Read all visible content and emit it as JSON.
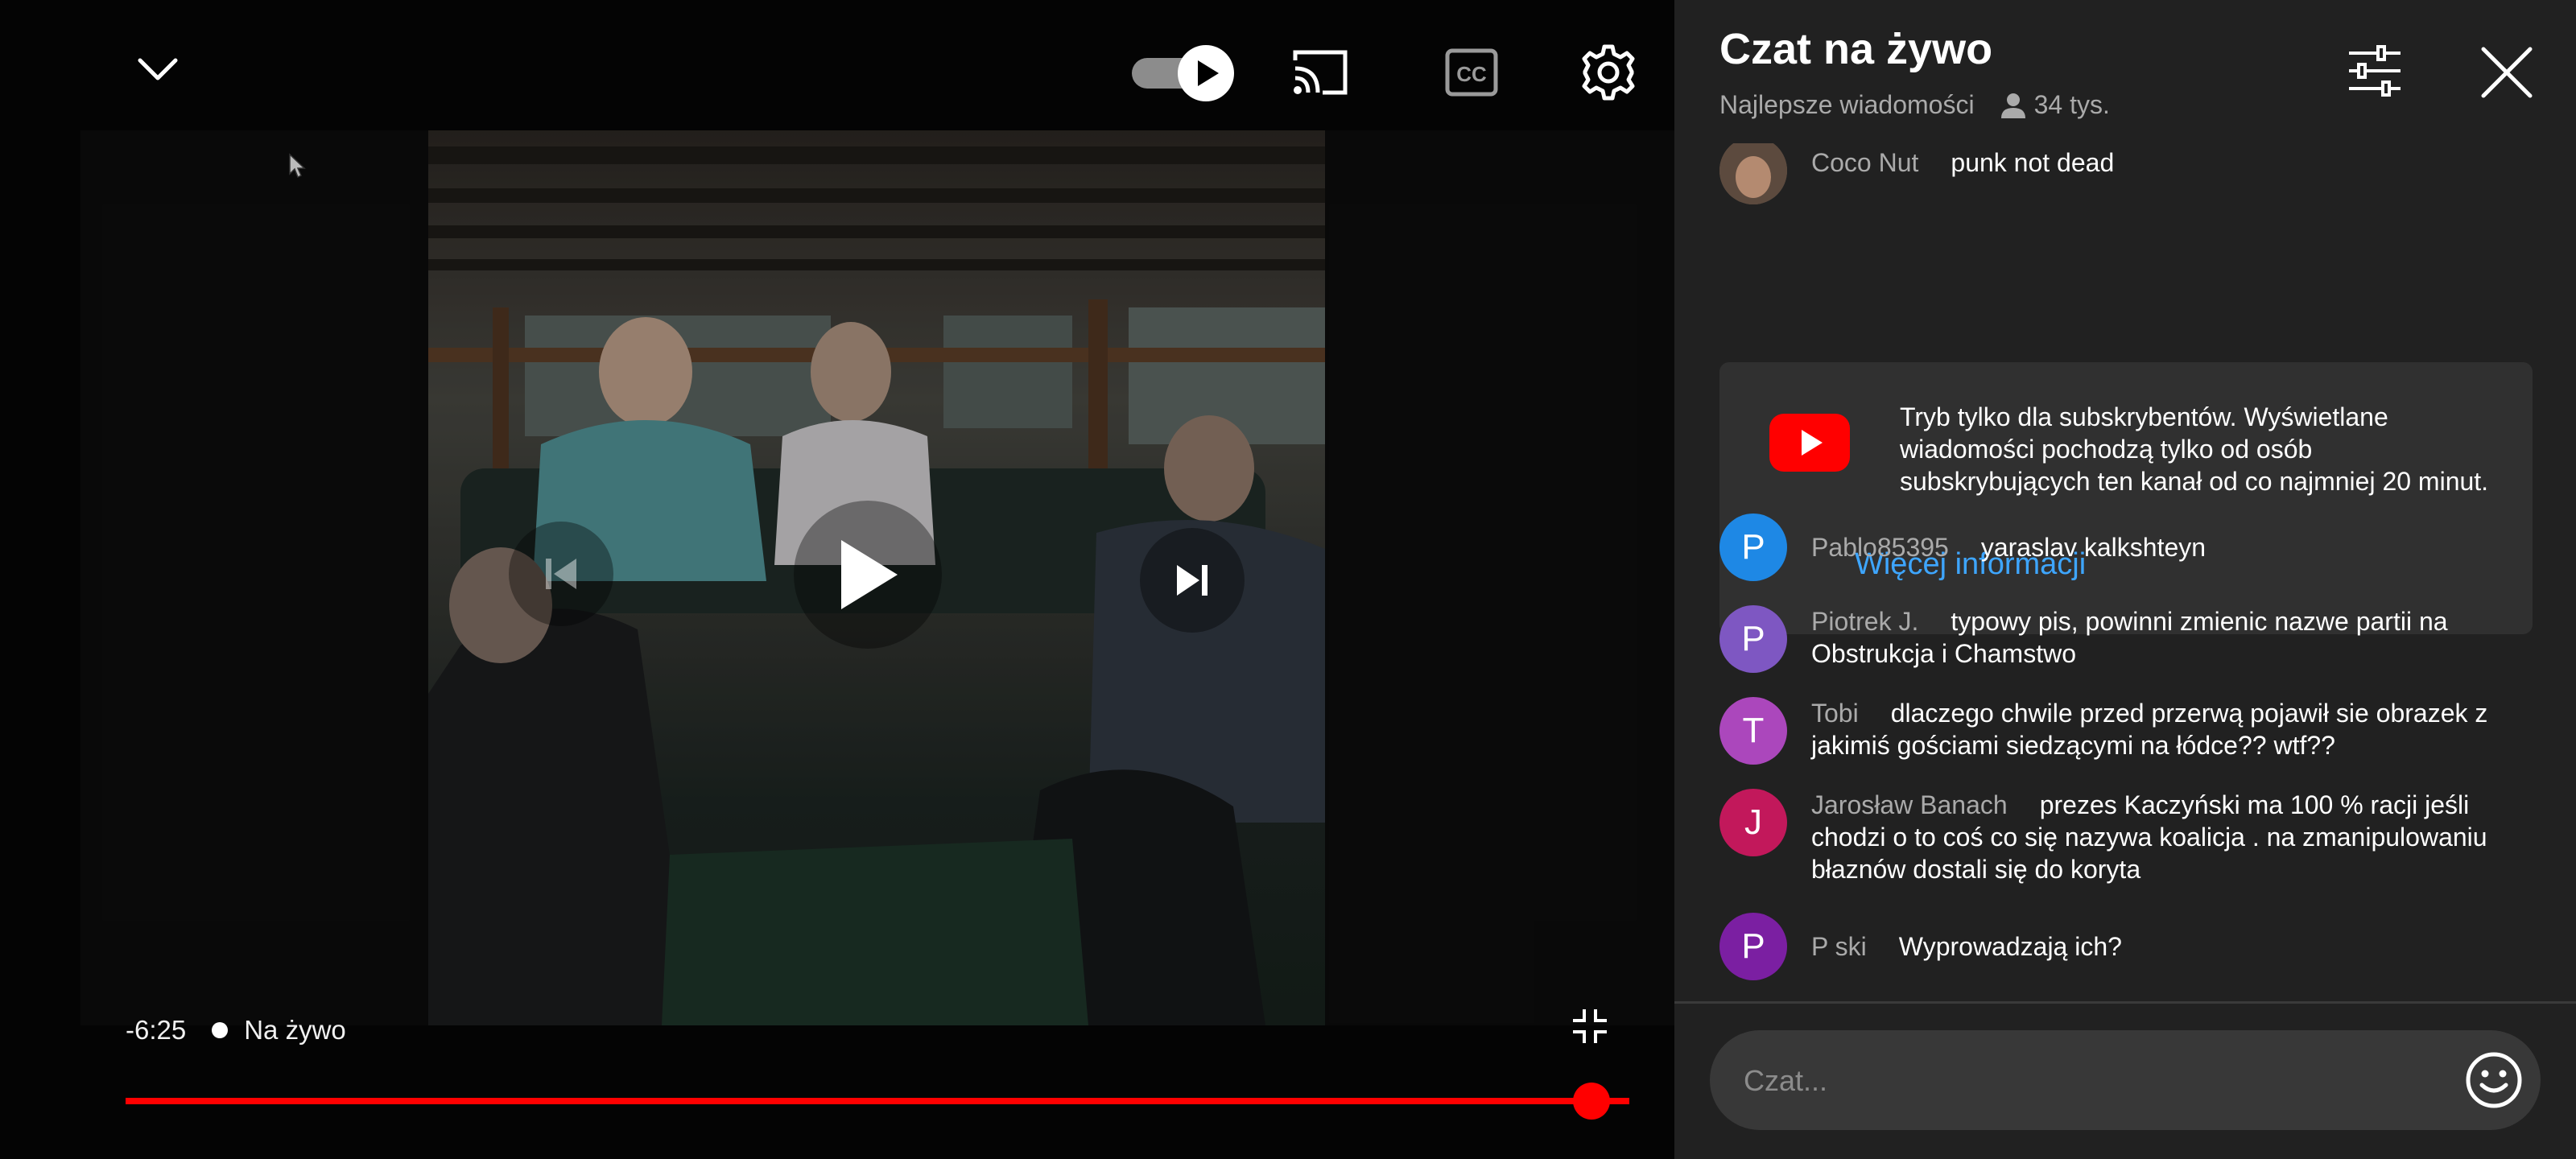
{
  "player": {
    "time_remaining": "-6:25",
    "live_label": "Na żywo",
    "progress_fraction": 0.975,
    "autoplay_on": true,
    "icons": [
      "chevron-down-icon",
      "autoplay-toggle",
      "cast-icon",
      "captions-icon",
      "gear-icon",
      "previous-icon",
      "play-icon",
      "next-icon",
      "exit-fullscreen-icon"
    ]
  },
  "chat": {
    "title": "Czat na żywo",
    "mode": "Najlepsze wiadomości",
    "viewers": "34 tys.",
    "notice": {
      "text": "Tryb tylko dla subskrybentów. Wyświetlane wiadomości pochodzą tylko od osób subskrybujących ten kanał od co najmniej 20 minut.",
      "link": "Więcej informacji"
    },
    "messages": [
      {
        "avatar": "",
        "author": "Coco Nut",
        "text": "punk not dead",
        "color": "#6b5a4e"
      },
      {
        "avatar": "P",
        "author": "Pablo85395",
        "text": "yaraslav kalkshteyn",
        "color": "#1e88e5"
      },
      {
        "avatar": "P",
        "author": "Piotrek J.",
        "text": "typowy pis, powinni zmienic nazwe partii na Obstrukcja i Chamstwo",
        "color": "#7e57c2"
      },
      {
        "avatar": "T",
        "author": "Tobi",
        "text": "dlaczego chwile przed przerwą pojawił sie obrazek z jakimiś gościami siedzącymi na łódce?? wtf??",
        "color": "#ab47bc"
      },
      {
        "avatar": "J",
        "author": "Jarosław Banach",
        "text": "prezes Kaczyński ma 100 % racji jeśli chodzi o to coś co się nazywa koalicja . na zmanipulowaniu błaznów dostali się do koryta",
        "color": "#c2185b"
      },
      {
        "avatar": "P",
        "author": "P ski",
        "text": "Wyprowadzają ich?",
        "color": "#7b1fa2"
      }
    ],
    "input_placeholder": "Czat...",
    "accent_color": "#3ea6ff"
  }
}
